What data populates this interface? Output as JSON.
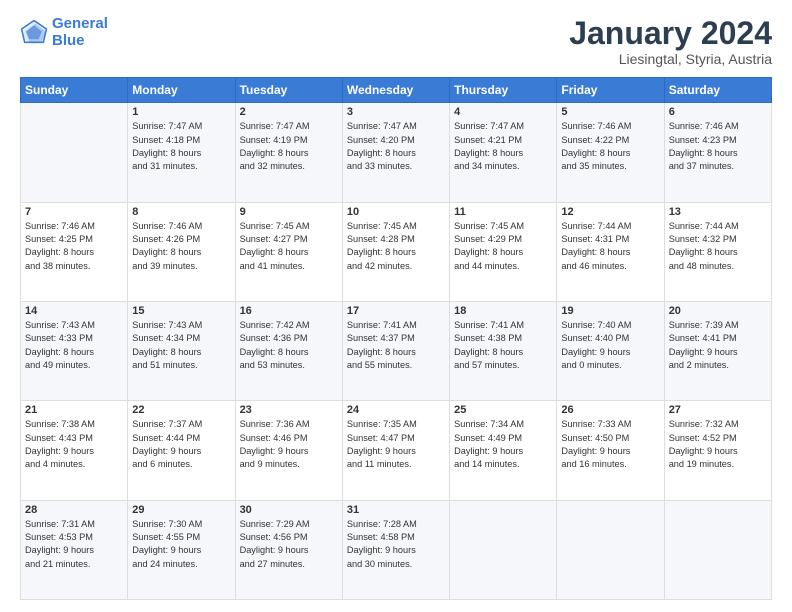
{
  "logo": {
    "line1": "General",
    "line2": "Blue"
  },
  "title": "January 2024",
  "subtitle": "Liesingtal, Styria, Austria",
  "days_header": [
    "Sunday",
    "Monday",
    "Tuesday",
    "Wednesday",
    "Thursday",
    "Friday",
    "Saturday"
  ],
  "weeks": [
    [
      {
        "num": "",
        "info": ""
      },
      {
        "num": "1",
        "info": "Sunrise: 7:47 AM\nSunset: 4:18 PM\nDaylight: 8 hours\nand 31 minutes."
      },
      {
        "num": "2",
        "info": "Sunrise: 7:47 AM\nSunset: 4:19 PM\nDaylight: 8 hours\nand 32 minutes."
      },
      {
        "num": "3",
        "info": "Sunrise: 7:47 AM\nSunset: 4:20 PM\nDaylight: 8 hours\nand 33 minutes."
      },
      {
        "num": "4",
        "info": "Sunrise: 7:47 AM\nSunset: 4:21 PM\nDaylight: 8 hours\nand 34 minutes."
      },
      {
        "num": "5",
        "info": "Sunrise: 7:46 AM\nSunset: 4:22 PM\nDaylight: 8 hours\nand 35 minutes."
      },
      {
        "num": "6",
        "info": "Sunrise: 7:46 AM\nSunset: 4:23 PM\nDaylight: 8 hours\nand 37 minutes."
      }
    ],
    [
      {
        "num": "7",
        "info": "Sunrise: 7:46 AM\nSunset: 4:25 PM\nDaylight: 8 hours\nand 38 minutes."
      },
      {
        "num": "8",
        "info": "Sunrise: 7:46 AM\nSunset: 4:26 PM\nDaylight: 8 hours\nand 39 minutes."
      },
      {
        "num": "9",
        "info": "Sunrise: 7:45 AM\nSunset: 4:27 PM\nDaylight: 8 hours\nand 41 minutes."
      },
      {
        "num": "10",
        "info": "Sunrise: 7:45 AM\nSunset: 4:28 PM\nDaylight: 8 hours\nand 42 minutes."
      },
      {
        "num": "11",
        "info": "Sunrise: 7:45 AM\nSunset: 4:29 PM\nDaylight: 8 hours\nand 44 minutes."
      },
      {
        "num": "12",
        "info": "Sunrise: 7:44 AM\nSunset: 4:31 PM\nDaylight: 8 hours\nand 46 minutes."
      },
      {
        "num": "13",
        "info": "Sunrise: 7:44 AM\nSunset: 4:32 PM\nDaylight: 8 hours\nand 48 minutes."
      }
    ],
    [
      {
        "num": "14",
        "info": "Sunrise: 7:43 AM\nSunset: 4:33 PM\nDaylight: 8 hours\nand 49 minutes."
      },
      {
        "num": "15",
        "info": "Sunrise: 7:43 AM\nSunset: 4:34 PM\nDaylight: 8 hours\nand 51 minutes."
      },
      {
        "num": "16",
        "info": "Sunrise: 7:42 AM\nSunset: 4:36 PM\nDaylight: 8 hours\nand 53 minutes."
      },
      {
        "num": "17",
        "info": "Sunrise: 7:41 AM\nSunset: 4:37 PM\nDaylight: 8 hours\nand 55 minutes."
      },
      {
        "num": "18",
        "info": "Sunrise: 7:41 AM\nSunset: 4:38 PM\nDaylight: 8 hours\nand 57 minutes."
      },
      {
        "num": "19",
        "info": "Sunrise: 7:40 AM\nSunset: 4:40 PM\nDaylight: 9 hours\nand 0 minutes."
      },
      {
        "num": "20",
        "info": "Sunrise: 7:39 AM\nSunset: 4:41 PM\nDaylight: 9 hours\nand 2 minutes."
      }
    ],
    [
      {
        "num": "21",
        "info": "Sunrise: 7:38 AM\nSunset: 4:43 PM\nDaylight: 9 hours\nand 4 minutes."
      },
      {
        "num": "22",
        "info": "Sunrise: 7:37 AM\nSunset: 4:44 PM\nDaylight: 9 hours\nand 6 minutes."
      },
      {
        "num": "23",
        "info": "Sunrise: 7:36 AM\nSunset: 4:46 PM\nDaylight: 9 hours\nand 9 minutes."
      },
      {
        "num": "24",
        "info": "Sunrise: 7:35 AM\nSunset: 4:47 PM\nDaylight: 9 hours\nand 11 minutes."
      },
      {
        "num": "25",
        "info": "Sunrise: 7:34 AM\nSunset: 4:49 PM\nDaylight: 9 hours\nand 14 minutes."
      },
      {
        "num": "26",
        "info": "Sunrise: 7:33 AM\nSunset: 4:50 PM\nDaylight: 9 hours\nand 16 minutes."
      },
      {
        "num": "27",
        "info": "Sunrise: 7:32 AM\nSunset: 4:52 PM\nDaylight: 9 hours\nand 19 minutes."
      }
    ],
    [
      {
        "num": "28",
        "info": "Sunrise: 7:31 AM\nSunset: 4:53 PM\nDaylight: 9 hours\nand 21 minutes."
      },
      {
        "num": "29",
        "info": "Sunrise: 7:30 AM\nSunset: 4:55 PM\nDaylight: 9 hours\nand 24 minutes."
      },
      {
        "num": "30",
        "info": "Sunrise: 7:29 AM\nSunset: 4:56 PM\nDaylight: 9 hours\nand 27 minutes."
      },
      {
        "num": "31",
        "info": "Sunrise: 7:28 AM\nSunset: 4:58 PM\nDaylight: 9 hours\nand 30 minutes."
      },
      {
        "num": "",
        "info": ""
      },
      {
        "num": "",
        "info": ""
      },
      {
        "num": "",
        "info": ""
      }
    ]
  ]
}
